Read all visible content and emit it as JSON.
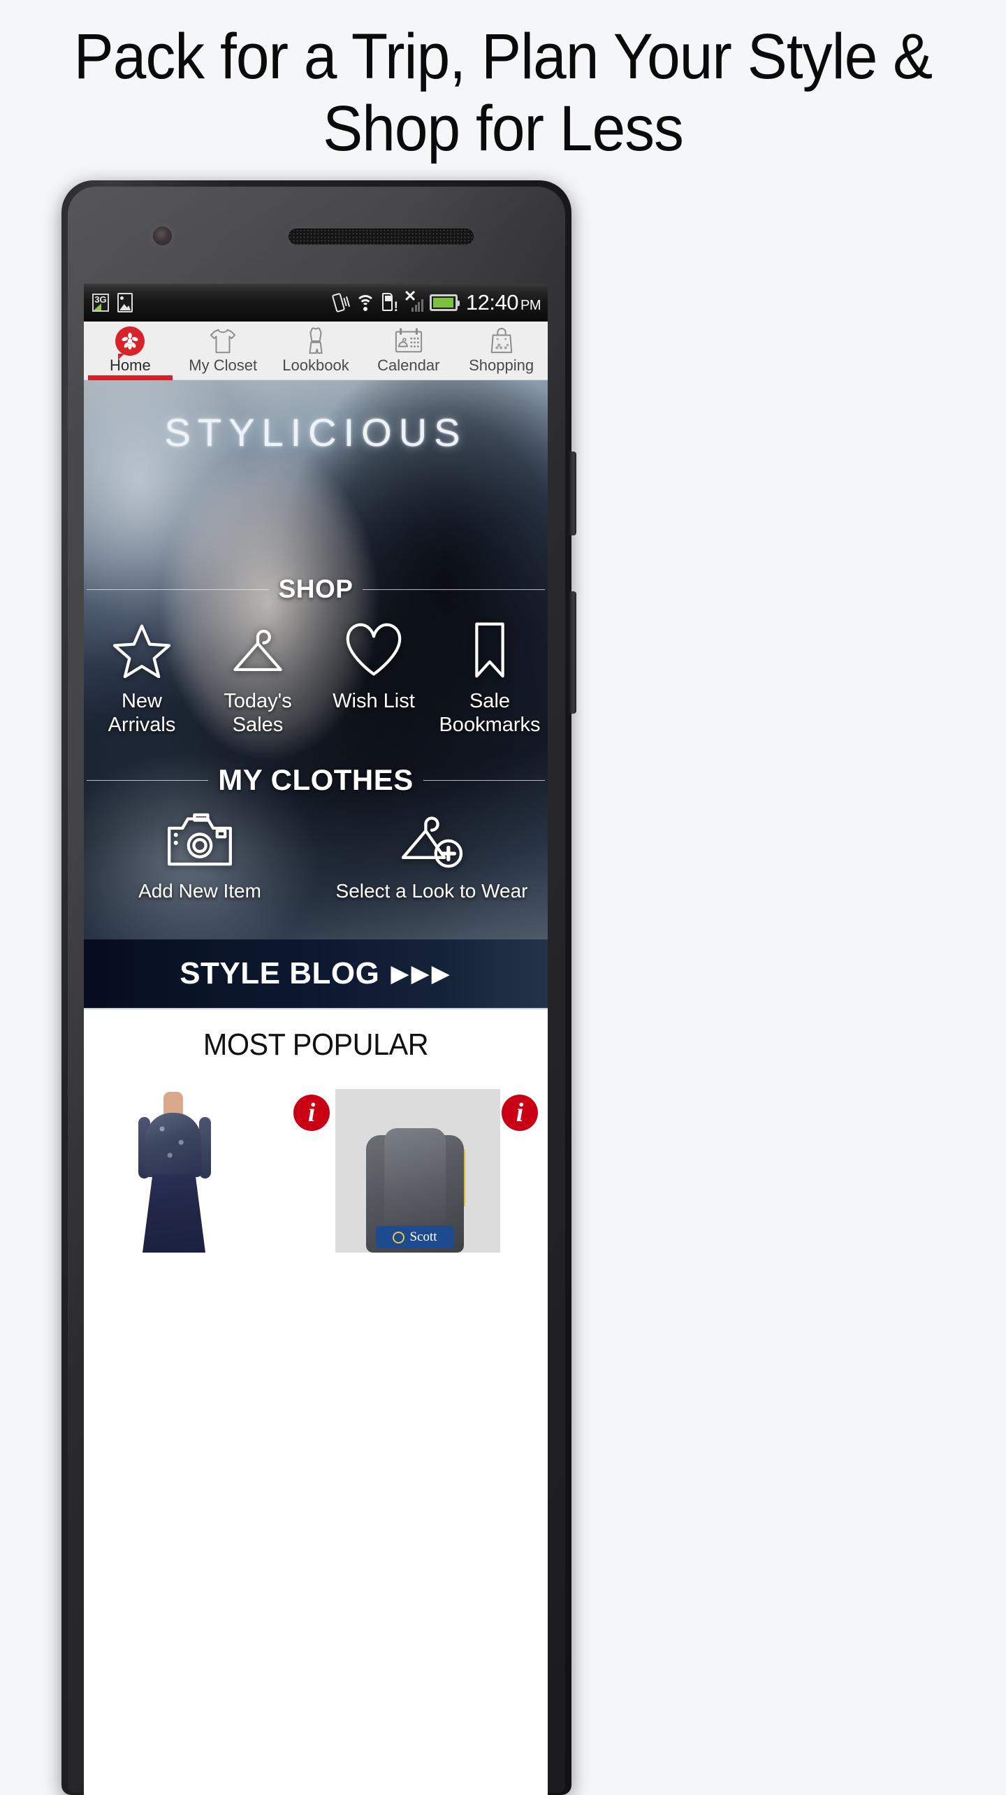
{
  "headline": "Pack for a Trip, Plan Your Style & Shop for Less",
  "colors": {
    "page_bg": "#f4f6f7",
    "accent_red": "#d81f26",
    "badge_red": "#ca0014",
    "blog_bar": "#0d1830",
    "battery_green": "#7cc241"
  },
  "status_bar": {
    "network_label": "3G",
    "icons": [
      "3g-icon",
      "photo-icon",
      "vibrate-icon",
      "wifi-icon",
      "sim-card-alert-icon",
      "no-signal-icon",
      "battery-icon"
    ],
    "time": "12:40",
    "meridiem": "PM"
  },
  "nav_tabs": [
    {
      "label": "Home",
      "icon": "flower-badge-icon",
      "active": true
    },
    {
      "label": "My Closet",
      "icon": "tshirt-icon",
      "active": false
    },
    {
      "label": "Lookbook",
      "icon": "dress-icon",
      "active": false
    },
    {
      "label": "Calendar",
      "icon": "calendar-hanger-icon",
      "active": false
    },
    {
      "label": "Shopping",
      "icon": "shopping-bag-icon",
      "active": false
    }
  ],
  "hero": {
    "brand": "STYLICIOUS"
  },
  "shop_section": {
    "title": "SHOP",
    "items": [
      {
        "label": "New Arrivals",
        "icon": "star-icon"
      },
      {
        "label": "Today's Sales",
        "icon": "hanger-icon"
      },
      {
        "label": "Wish List",
        "icon": "heart-icon"
      },
      {
        "label": "Sale Bookmarks",
        "icon": "bookmark-icon"
      }
    ]
  },
  "clothes_section": {
    "title": "MY CLOTHES",
    "items": [
      {
        "label": "Add New Item",
        "icon": "camera-icon"
      },
      {
        "label": "Select a Look to Wear",
        "icon": "hanger-plus-icon"
      }
    ]
  },
  "blog_bar": {
    "label": "STYLE BLOG",
    "arrows": "▶▶▶"
  },
  "popular_section": {
    "title": "MOST POPULAR",
    "products": [
      {
        "name": "navy-sequin-gown",
        "badge": "i"
      },
      {
        "name": "scott-backpack",
        "badge": "i",
        "brand_label": "Scott"
      }
    ]
  }
}
